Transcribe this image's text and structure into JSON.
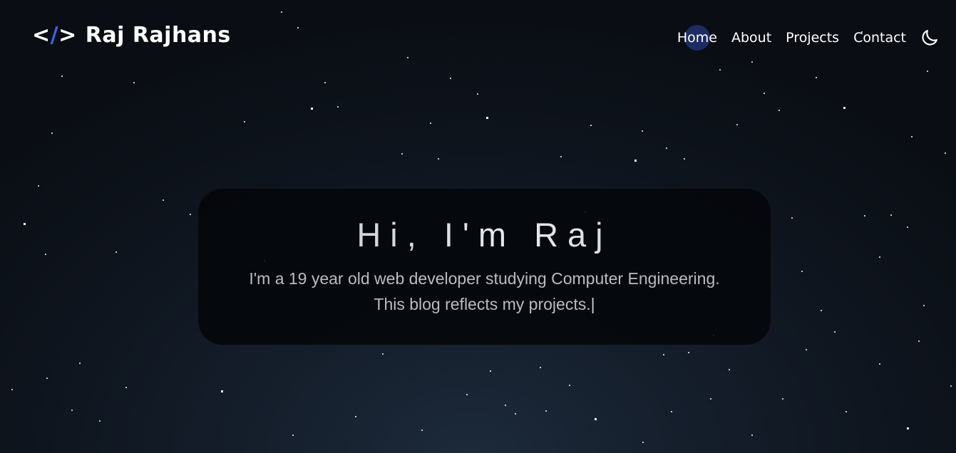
{
  "header": {
    "logo_icon": "</>",
    "logo_text": "Raj Rajhans"
  },
  "nav": {
    "items": [
      {
        "label": "Home",
        "active": true
      },
      {
        "label": "About",
        "active": false
      },
      {
        "label": "Projects",
        "active": false
      },
      {
        "label": "Contact",
        "active": false
      }
    ],
    "theme_toggle_icon": "moon-icon"
  },
  "hero": {
    "title": "Hi, I'm Raj",
    "line1": "I'm a 19 year old web developer studying Computer Engineering.",
    "line2": "This blog reflects my projects.",
    "cursor": "|"
  },
  "colors": {
    "accent": "#3f63ee",
    "active_highlight": "#1f3370",
    "background": "#0e141d",
    "card": "#05070a"
  }
}
